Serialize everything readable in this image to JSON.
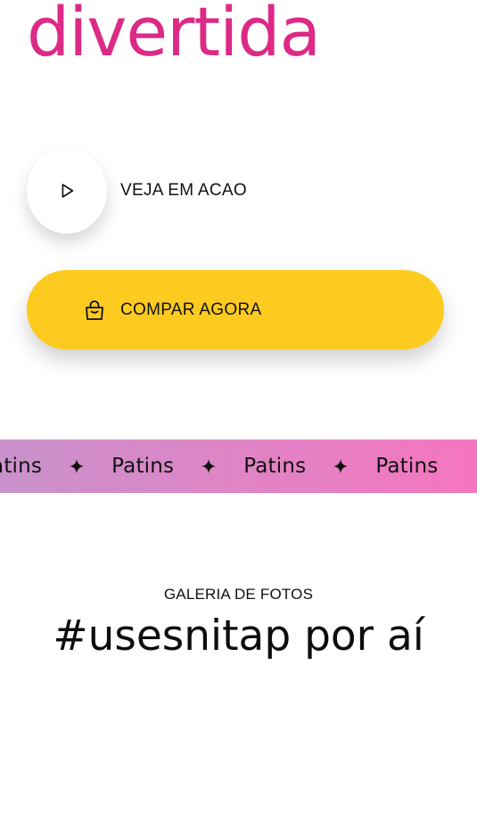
{
  "hero": {
    "word": "divertida",
    "color": "#dc2a86"
  },
  "video": {
    "label": "VEJA EM ACAO",
    "icon": "play-icon"
  },
  "buy": {
    "label": "COMPAR AGORA",
    "icon": "shopping-bag-icon",
    "color": "#fdcb1f"
  },
  "marquee": {
    "items": [
      "Patins",
      "Patins",
      "Patins",
      "Patins"
    ],
    "separator_icon": "four-point-star-icon",
    "gradient_start": "#c992cc",
    "gradient_end": "#f576bf"
  },
  "gallery": {
    "eyebrow": "GALERIA DE FOTOS",
    "title": "#usesnitap por aí"
  }
}
